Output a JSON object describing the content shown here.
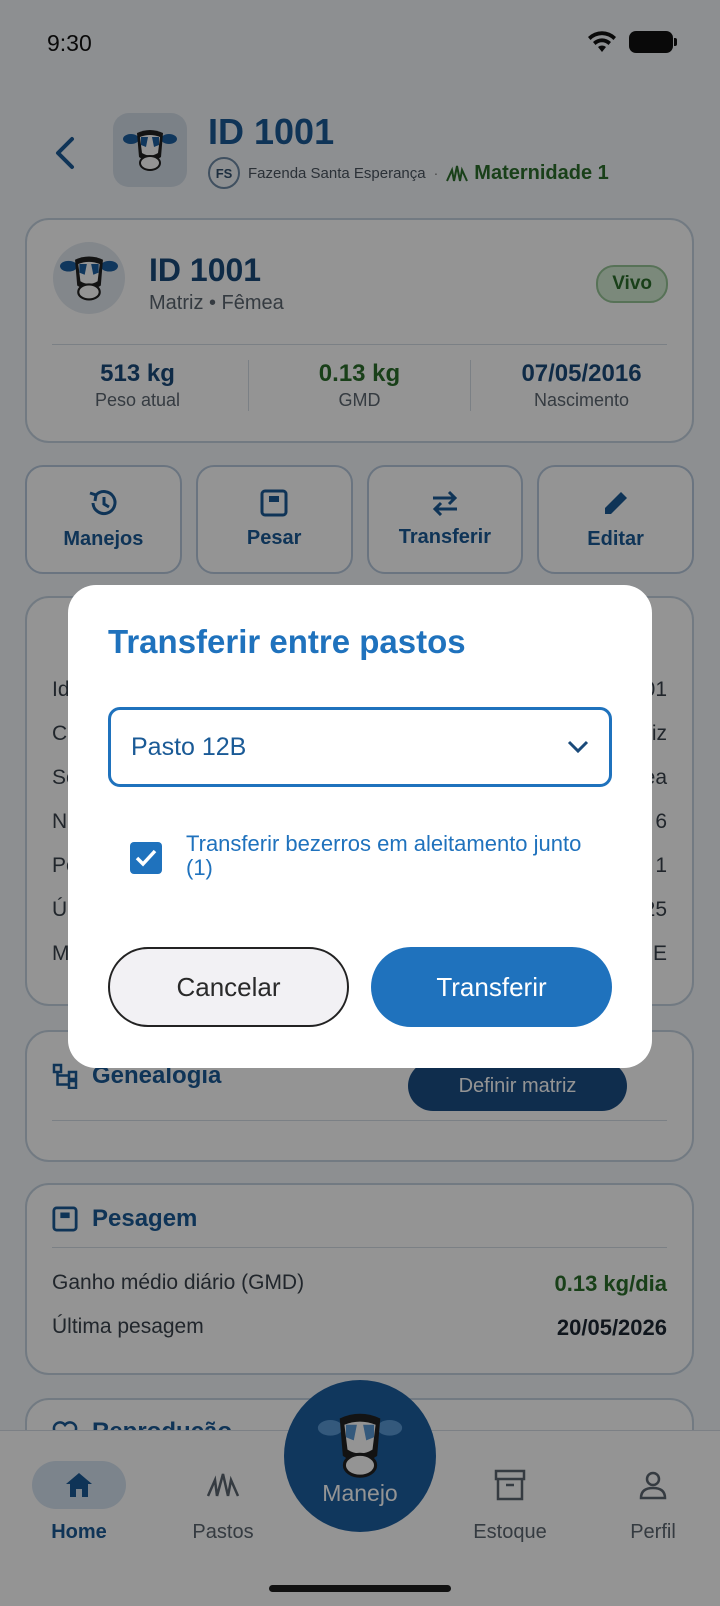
{
  "status_bar": {
    "time": "9:30"
  },
  "header": {
    "title": "ID 1001",
    "farm_badge": "FS",
    "farm_name": "Fazenda Santa Esperança",
    "separator": "·",
    "location": "Maternidade 1"
  },
  "animal_card": {
    "title": "ID 1001",
    "subtitle": "Matriz • Fêmea",
    "status_badge": "Vivo",
    "stats": [
      {
        "value": "513 kg",
        "label": "Peso atual"
      },
      {
        "value": "0.13 kg",
        "label": "GMD"
      },
      {
        "value": "07/05/2016",
        "label": "Nascimento"
      }
    ]
  },
  "actions": [
    {
      "label": "Manejos",
      "icon": "history-icon"
    },
    {
      "label": "Pesar",
      "icon": "scale-icon"
    },
    {
      "label": "Transferir",
      "icon": "swap-icon"
    },
    {
      "label": "Editar",
      "icon": "pencil-icon"
    }
  ],
  "info_rows": [
    {
      "label": "Id",
      "value": "01"
    },
    {
      "label": "Ca",
      "value": "iz"
    },
    {
      "label": "Se",
      "value": "ea"
    },
    {
      "label": "N",
      "value": "6"
    },
    {
      "label": "Pe",
      "value": "1"
    },
    {
      "label": "Ú",
      "value": "25"
    },
    {
      "label": "M",
      "value": "SE"
    }
  ],
  "genealogia": {
    "title": "Genealogia",
    "button": "Definir matriz"
  },
  "pesagem": {
    "title": "Pesagem",
    "rows": [
      {
        "label": "Ganho médio diário (GMD)",
        "value": "0.13 kg/dia"
      },
      {
        "label": "Última pesagem",
        "value": "20/05/2026"
      }
    ]
  },
  "reproducao": {
    "title": "Reprodução"
  },
  "bottom_nav": {
    "items": [
      {
        "label": "Home"
      },
      {
        "label": "Pastos"
      },
      {
        "label": "Manejo"
      },
      {
        "label": "Estoque"
      },
      {
        "label": "Perfil"
      }
    ]
  },
  "dialog": {
    "title": "Transferir entre pastos",
    "select_value": "Pasto 12B",
    "checkbox_label": "Transferir bezerros em aleitamento junto (1)",
    "checkbox_checked": true,
    "cancel_label": "Cancelar",
    "confirm_label": "Transferir"
  },
  "colors": {
    "primary": "#1f72bd",
    "dark_primary": "#1a5a96",
    "success": "#2c6e2c"
  }
}
